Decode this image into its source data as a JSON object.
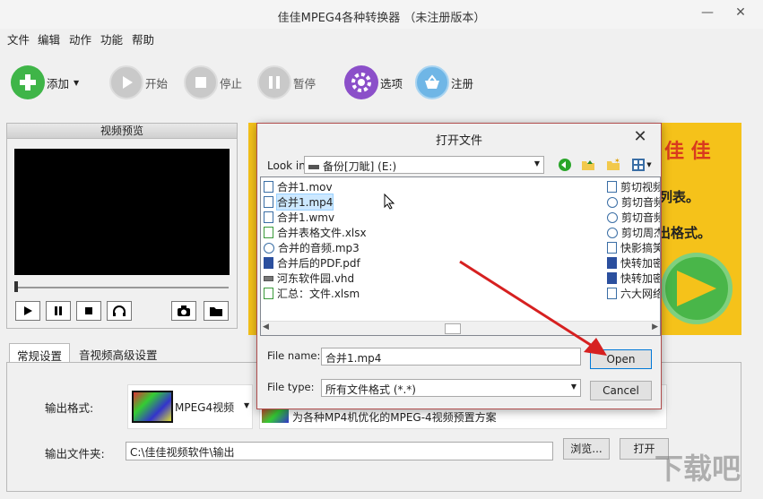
{
  "window": {
    "title": "佳佳MPEG4各种转换器 （未注册版本）",
    "minimize": "—",
    "close": "✕"
  },
  "menu": [
    "文件",
    "编辑",
    "动作",
    "功能",
    "帮助"
  ],
  "toolbar": {
    "add": "添加",
    "start": "开始",
    "stop": "停止",
    "pause": "暂停",
    "options": "选项",
    "register": "注册"
  },
  "preview": {
    "header": "视频预览"
  },
  "banner": {
    "line1": "佳 佳",
    "line2": "列表。",
    "line3": "出格式。"
  },
  "tabs": [
    "常规设置",
    "音视频高级设置"
  ],
  "settings": {
    "output_format_label": "输出格式:",
    "output_format_value": "MPEG4视频",
    "format_desc": "为各种MP4机优化的MPEG-4视频预置方案",
    "output_folder_label": "输出文件夹:",
    "output_folder_value": "C:\\佳佳视频软件\\输出",
    "browse": "浏览...",
    "open": "打开"
  },
  "dialog": {
    "title": "打开文件",
    "look_in_label": "Look in:",
    "look_in_value": "备份[刀眦] (E:)",
    "files_left": [
      {
        "name": "合并1.mov",
        "type": "doc"
      },
      {
        "name": "合并1.mp4",
        "type": "doc",
        "selected": true
      },
      {
        "name": "合并1.wmv",
        "type": "doc"
      },
      {
        "name": "合并表格文件.xlsx",
        "type": "xls"
      },
      {
        "name": "合并的音频.mp3",
        "type": "audio"
      },
      {
        "name": "合并后的PDF.pdf",
        "type": "pdf"
      },
      {
        "name": "河东软件园.vhd",
        "type": "vhd"
      },
      {
        "name": "汇总：文件.xlsm",
        "type": "xls"
      }
    ],
    "files_right": [
      {
        "name": "剪切视频",
        "type": "doc"
      },
      {
        "name": "剪切音频",
        "type": "audio"
      },
      {
        "name": "剪切音频",
        "type": "audio"
      },
      {
        "name": "剪切周杰",
        "type": "audio"
      },
      {
        "name": "快影搞笑",
        "type": "doc"
      },
      {
        "name": "快转加密",
        "type": "pdf"
      },
      {
        "name": "快转加密",
        "type": "pdf"
      },
      {
        "name": "六大网络",
        "type": "doc"
      }
    ],
    "file_name_label": "File name:",
    "file_name_value": "合并1.mp4",
    "file_type_label": "File type:",
    "file_type_value": "所有文件格式 (*.*)",
    "open_button": "Open",
    "cancel_button": "Cancel"
  },
  "watermark": "下载吧"
}
